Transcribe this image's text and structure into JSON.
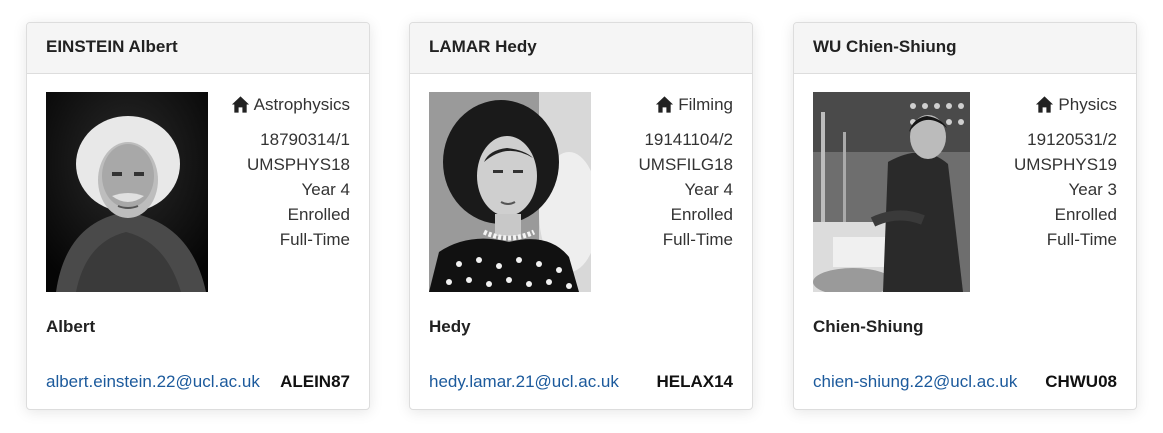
{
  "students": [
    {
      "name": "EINSTEIN Albert",
      "department": "Astrophysics",
      "student_number": "18790314/1",
      "programme": "UMSPHYS18",
      "year": "Year 4",
      "status": "Enrolled",
      "mode": "Full-Time",
      "preferred_name": "Albert",
      "email": "albert.einstein.22@ucl.ac.uk",
      "user_id": "ALEIN87"
    },
    {
      "name": "LAMAR Hedy",
      "department": "Filming",
      "student_number": "19141104/2",
      "programme": "UMSFILG18",
      "year": "Year 4",
      "status": "Enrolled",
      "mode": "Full-Time",
      "preferred_name": "Hedy",
      "email": "hedy.lamar.21@ucl.ac.uk",
      "user_id": "HELAX14"
    },
    {
      "name": "WU Chien-Shiung",
      "department": "Physics",
      "student_number": "19120531/2",
      "programme": "UMSPHYS19",
      "year": "Year 3",
      "status": "Enrolled",
      "mode": "Full-Time",
      "preferred_name": "Chien-Shiung",
      "email": "chien-shiung.22@ucl.ac.uk",
      "user_id": "CHWU08"
    }
  ],
  "icons": {
    "department": "home-icon"
  },
  "colors": {
    "link": "#1c5a9c",
    "header_bg": "#f5f5f5",
    "border": "#dddddd"
  }
}
